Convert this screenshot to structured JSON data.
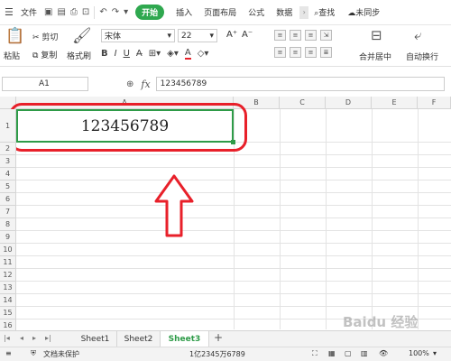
{
  "menubar": {
    "file_label": "文件",
    "active_tab": "开始",
    "tabs": [
      "插入",
      "页面布局",
      "公式",
      "数据"
    ],
    "search_label": "查找",
    "sync_label": "未同步"
  },
  "ribbon": {
    "cut_label": "剪切",
    "paste_label": "粘贴",
    "copy_label": "复制",
    "format_painter_label": "格式刷",
    "font_name": "宋体",
    "font_size": "22",
    "merge_label": "合并居中",
    "wrap_label": "自动换行"
  },
  "formula_bar": {
    "cell_ref": "A1",
    "fx_label": "fx",
    "value": "123456789"
  },
  "grid": {
    "columns": [
      "A",
      "B",
      "C",
      "D",
      "E",
      "F"
    ],
    "rows": [
      "1",
      "2",
      "3",
      "4",
      "5",
      "6",
      "7",
      "8",
      "9",
      "10",
      "11",
      "12",
      "13",
      "14",
      "15",
      "16",
      "17",
      "18"
    ],
    "a1_value": "123456789"
  },
  "sheets": {
    "tabs": [
      "Sheet1",
      "Sheet2",
      "Sheet3"
    ],
    "active": "Sheet3",
    "add_label": "+"
  },
  "status": {
    "protect_label": "文档未保护",
    "cell_display": "1亿2345万6789",
    "zoom": "100%"
  },
  "watermark": "Baidu 经验",
  "colors": {
    "accent_green": "#2e9b48",
    "annotation_red": "#e8202a"
  }
}
